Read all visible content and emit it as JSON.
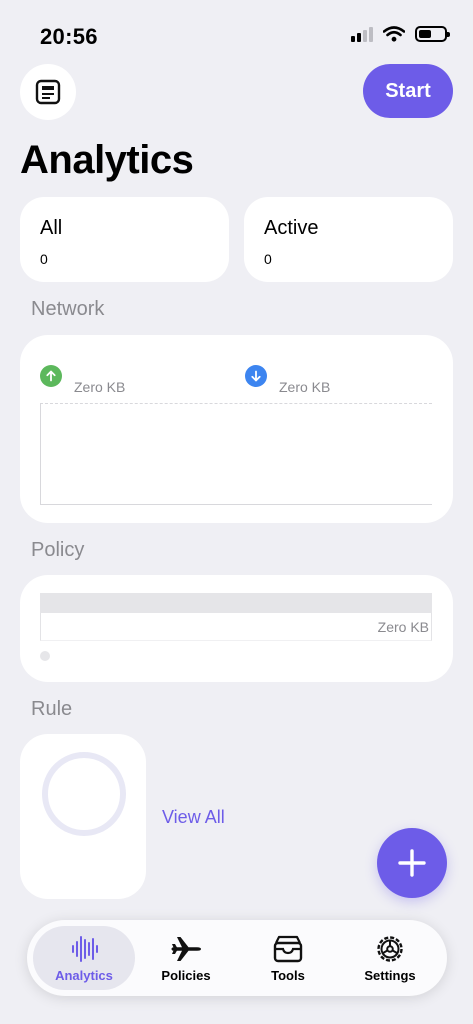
{
  "status_bar": {
    "time": "20:56"
  },
  "header": {
    "start_label": "Start",
    "title": "Analytics"
  },
  "stats": [
    {
      "label": "All",
      "value": "0"
    },
    {
      "label": "Active",
      "value": "0"
    }
  ],
  "network": {
    "title": "Network",
    "upload": {
      "value": "Zero KB",
      "color": "#5cb85c"
    },
    "download": {
      "value": "Zero KB",
      "color": "#3d85f0"
    }
  },
  "policy": {
    "title": "Policy",
    "value": "Zero KB"
  },
  "rule": {
    "title": "Rule",
    "view_all": "View All"
  },
  "tabs": [
    {
      "label": "Analytics",
      "icon": "waveform-icon",
      "active": true
    },
    {
      "label": "Policies",
      "icon": "airplane-icon",
      "active": false
    },
    {
      "label": "Tools",
      "icon": "tray-icon",
      "active": false
    },
    {
      "label": "Settings",
      "icon": "gear-icon",
      "active": false
    }
  ],
  "colors": {
    "accent": "#6d5ce8",
    "background": "#efeff4"
  }
}
